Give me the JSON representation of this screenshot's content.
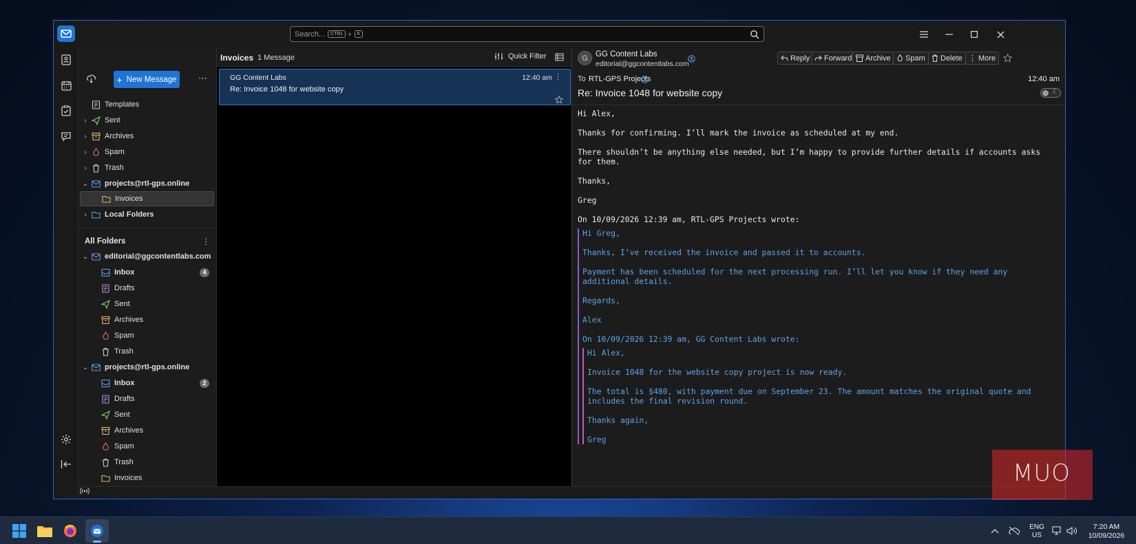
{
  "search": {
    "placeholder": "Search...",
    "key_ctrl": "CTRL",
    "key_plus": "+",
    "key_k": "K"
  },
  "folders": {
    "new_message": "New Message",
    "top": [
      {
        "label": "Templates",
        "icon": "templates-icon"
      },
      {
        "label": "Sent",
        "icon": "sent-icon"
      },
      {
        "label": "Archives",
        "icon": "archives-icon"
      },
      {
        "label": "Spam",
        "icon": "spam-icon"
      },
      {
        "label": "Trash",
        "icon": "trash-icon"
      }
    ],
    "account_projects": "projects@rtl-gps.online",
    "invoices": "Invoices",
    "local_folders": "Local Folders",
    "all_folders": "All Folders",
    "account_editorial": "editorial@ggcontentlabs.com",
    "editorial_items": [
      {
        "label": "Inbox",
        "badge": "4"
      },
      {
        "label": "Drafts"
      },
      {
        "label": "Sent"
      },
      {
        "label": "Archives"
      },
      {
        "label": "Spam"
      },
      {
        "label": "Trash"
      }
    ],
    "account_projects2": "projects@rtl-gps.online",
    "projects_items": [
      {
        "label": "Inbox",
        "badge": "2"
      },
      {
        "label": "Drafts"
      },
      {
        "label": "Sent"
      },
      {
        "label": "Archives"
      },
      {
        "label": "Spam"
      },
      {
        "label": "Trash"
      },
      {
        "label": "Invoices"
      }
    ]
  },
  "list": {
    "folder_name": "Invoices",
    "count": "1 Message",
    "quick_filter": "Quick Filter",
    "message": {
      "sender": "GG Content Labs",
      "time": "12:40 am",
      "subject": "Re: Invoice 1048 for website copy"
    }
  },
  "reader": {
    "avatar_letter": "G",
    "from_name": "GG Content Labs",
    "from_email": "editorial@ggcontentlabs.com",
    "to_label": "To",
    "to_name": "RTL-GPS Projects",
    "time": "12:40 am",
    "subject": "Re: Invoice 1048 for website copy",
    "actions": {
      "reply": "Reply",
      "forward": "Forward",
      "archive": "Archive",
      "spam": "Spam",
      "delete": "Delete",
      "more": "More"
    },
    "body": {
      "greeting": "Hi Alex,",
      "p1": "Thanks for confirming. I’ll mark the invoice as scheduled at my end.",
      "p2": "There shouldn’t be anything else needed, but I’m happy to provide further details if accounts asks\nfor them.",
      "signoff": "Thanks,",
      "name": "Greg",
      "attrib1": "On 10/09/2026 12:39 am, RTL-GPS Projects wrote:",
      "q1_greeting": "Hi Greg,",
      "q1_p1": "Thanks, I’ve received the invoice and passed it to accounts.",
      "q1_p2": "Payment has been scheduled for the next processing run. I’ll let you know if they need any\nadditional details.",
      "q1_signoff": "Regards,",
      "q1_name": "Alex",
      "attrib2": "On 10/09/2026 12:39 am, GG Content Labs wrote:",
      "q2_greeting": "Hi Alex,",
      "q2_p1": "Invoice 1048 for the website copy project is now ready.",
      "q2_p2": "The total is $480, with payment due on September 23. The amount matches the original quote and\nincludes the final revision round.",
      "q2_signoff": "Thanks again,",
      "q2_name": "Greg"
    }
  },
  "taskbar": {
    "lang1": "ENG",
    "lang2": "US",
    "clock_time": "7:20 AM",
    "clock_date": "10/09/2026"
  },
  "watermark": "MUO",
  "colors": {
    "accent": "#1f74d6",
    "selection": "#163356",
    "quote_text": "#5aa4e8"
  }
}
